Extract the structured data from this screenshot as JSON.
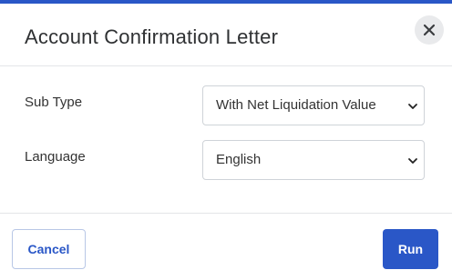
{
  "dialog": {
    "title": "Account Confirmation Letter",
    "accent_color": "#2a57c7",
    "close_icon": "close-icon"
  },
  "form": {
    "sub_type": {
      "label": "Sub Type",
      "selected": "With Net Liquidation Value"
    },
    "language": {
      "label": "Language",
      "selected": "English"
    }
  },
  "footer": {
    "cancel_label": "Cancel",
    "run_label": "Run"
  }
}
